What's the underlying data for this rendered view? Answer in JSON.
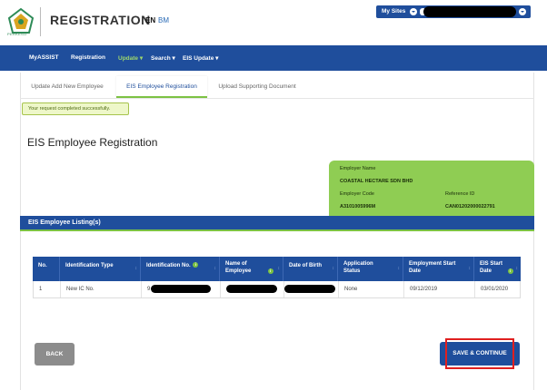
{
  "header": {
    "logo_text": "PERKESO",
    "app_title": "REGISTRATION",
    "lang_en": "EN",
    "lang_bm": "BM",
    "my_sites_label": "My Sites"
  },
  "nav": {
    "items": [
      {
        "label": "MyASSIST"
      },
      {
        "label": "Registration"
      },
      {
        "label": "Update ▾"
      },
      {
        "label": "Search ▾"
      },
      {
        "label": "EIS Update ▾"
      }
    ]
  },
  "tabs": [
    {
      "label": "Update Add New Employee"
    },
    {
      "label": "EIS Employee Registration"
    },
    {
      "label": "Upload Supporting Document"
    }
  ],
  "alert": {
    "text": "Your request completed successfully."
  },
  "page_title": "EIS Employee Registration",
  "employer": {
    "name_label": "Employer Name",
    "name_value": "COASTAL HECTARE SDN BHD",
    "code_label": "Employer Code",
    "code_value": "A3101005996M",
    "ref_label": "Reference ID",
    "ref_value": "CAN01202000022791"
  },
  "listing": {
    "title": "EIS Employee Listing(s)",
    "columns": [
      {
        "label": "No."
      },
      {
        "label": "Identification Type"
      },
      {
        "label": "Identification No."
      },
      {
        "label": "Name of Employee"
      },
      {
        "label": "Date of Birth"
      },
      {
        "label": "Application Status"
      },
      {
        "label": "Employment Start Date"
      },
      {
        "label": "EIS Start Date"
      }
    ],
    "rows": [
      {
        "no": "1",
        "id_type": "New IC No.",
        "id_no_prefix": "9",
        "status": "None",
        "emp_start": "09/12/2019",
        "eis_start": "03/01/2020"
      }
    ]
  },
  "buttons": {
    "back": "BACK",
    "save": "SAVE & CONTINUE"
  },
  "colors": {
    "primary": "#1f4e9c",
    "accent_green": "#8fcd53",
    "highlight": "#e01f1f"
  }
}
